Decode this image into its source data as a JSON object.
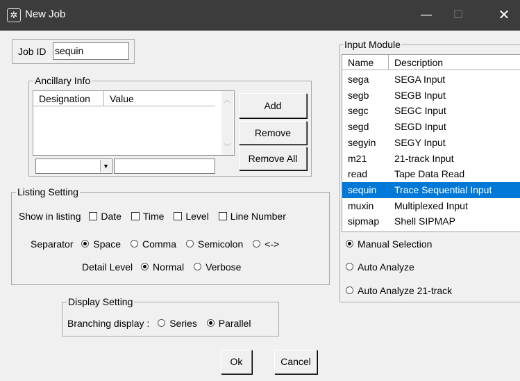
{
  "window": {
    "title": "New Job",
    "minimize": "—",
    "maximize": "☐",
    "close": "✕",
    "icon": "settings-gear-icon"
  },
  "job": {
    "label": "Job ID",
    "value": "sequin"
  },
  "ancillary": {
    "legend": "Ancillary Info",
    "columns": [
      "Designation",
      "Value"
    ],
    "designation_value": "",
    "value_value": "",
    "add": "Add",
    "remove": "Remove",
    "remove_all": "Remove All"
  },
  "listing": {
    "legend": "Listing Setting",
    "show_label": "Show in listing",
    "checkboxes": [
      {
        "label": "Date",
        "checked": false
      },
      {
        "label": "Time",
        "checked": false
      },
      {
        "label": "Level",
        "checked": false
      },
      {
        "label": "Line Number",
        "checked": false
      }
    ],
    "separator_label": "Separator",
    "separators": [
      {
        "label": "Space",
        "selected": true
      },
      {
        "label": "Comma",
        "selected": false
      },
      {
        "label": "Semicolon",
        "selected": false
      },
      {
        "label": "<->",
        "selected": false
      }
    ],
    "detail_label": "Detail Level",
    "details": [
      {
        "label": "Normal",
        "selected": true
      },
      {
        "label": "Verbose",
        "selected": false
      }
    ]
  },
  "display": {
    "legend": "Display Setting",
    "branching_label": "Branching display :",
    "options": [
      {
        "label": "Series",
        "selected": false
      },
      {
        "label": "Parallel",
        "selected": true
      }
    ]
  },
  "input_module": {
    "legend": "Input Module",
    "columns": [
      "Name",
      "Description"
    ],
    "rows": [
      {
        "name": "sega",
        "desc": "SEGA Input"
      },
      {
        "name": "segb",
        "desc": "SEGB Input"
      },
      {
        "name": "segc",
        "desc": "SEGC Input"
      },
      {
        "name": "segd",
        "desc": "SEGD Input"
      },
      {
        "name": "segyin",
        "desc": "SEGY Input"
      },
      {
        "name": "m21",
        "desc": "21-track Input"
      },
      {
        "name": "read",
        "desc": "Tape Data Read"
      },
      {
        "name": "sequin",
        "desc": "Trace Sequential Input"
      },
      {
        "name": "muxin",
        "desc": "Multiplexed Input"
      },
      {
        "name": "sipmap",
        "desc": "Shell SIPMAP"
      }
    ],
    "selected_row": "sequin",
    "modes": [
      {
        "label": "Manual Selection",
        "selected": true
      },
      {
        "label": "Auto Analyze",
        "selected": false
      },
      {
        "label": "Auto Analyze 21-track",
        "selected": false
      }
    ]
  },
  "footer": {
    "ok": "Ok",
    "cancel": "Cancel"
  },
  "colors": {
    "titlebar": "#3c3c3c",
    "selection": "#0078d7",
    "dialog_bg": "#f0f0f0"
  }
}
